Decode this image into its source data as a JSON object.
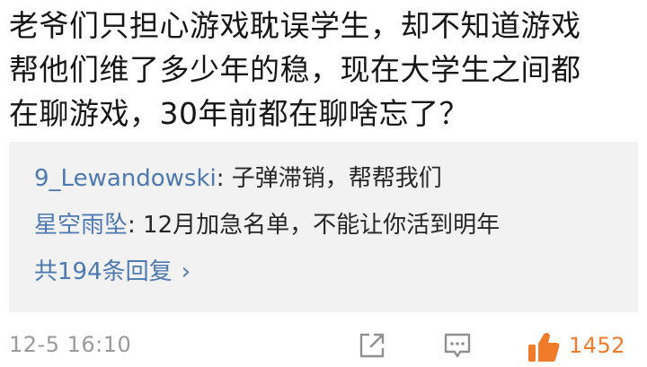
{
  "post": {
    "lines": [
      "老爷们只担心游戏耽误学生，却不知道游戏",
      "帮他们维了多少年的稳，现在大学生之间都",
      "在聊游戏，30年前都在聊啥忘了？"
    ]
  },
  "replies": {
    "items": [
      {
        "user": "9_Lewandowski",
        "separator": ": ",
        "text": "子弹滞销，帮帮我们"
      },
      {
        "user": "星空雨坠",
        "separator": ": ",
        "text": "12月加急名单，不能让你活到明年"
      }
    ],
    "more_label": "共194条回复",
    "more_icon": "chevron-right-icon"
  },
  "footer": {
    "timestamp": "12-5 16:10",
    "share_icon": "share-icon",
    "comment_icon": "comment-icon",
    "like_icon": "thumbs-up-icon",
    "like_count": "1452"
  },
  "colors": {
    "link": "#4d79b1",
    "like": "#f07b2b",
    "muted": "#9a9a9a",
    "reply_bg": "#f2f2f2"
  }
}
